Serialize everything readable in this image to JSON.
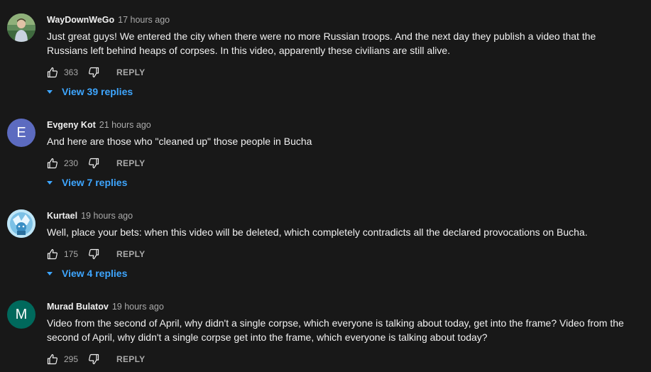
{
  "comments": [
    {
      "author": "WayDownWeGo",
      "time": "17 hours ago",
      "text": "Just great guys! We entered the city when there were no more Russian troops. And the next day they publish a video that the Russians left behind heaps of corpses. In this video, apparently these civilians are still alive.",
      "likes": "363",
      "reply_label": "REPLY",
      "view_replies": "View 39 replies",
      "avatar": {
        "type": "photo",
        "icon": "user-photo"
      }
    },
    {
      "author": "Evgeny Kot",
      "time": "21 hours ago",
      "text": "And here are those who \"cleaned up\" those people in Bucha",
      "likes": "230",
      "reply_label": "REPLY",
      "view_replies": "View 7 replies",
      "avatar": {
        "type": "letter",
        "letter": "E",
        "color": "#5c6bc0"
      }
    },
    {
      "author": "Kurtael",
      "time": "19 hours ago",
      "text": "Well, place your bets: when this video will be deleted, which completely contradicts all the declared provocations on Bucha.",
      "likes": "175",
      "reply_label": "REPLY",
      "view_replies": "View 4 replies",
      "avatar": {
        "type": "photo",
        "icon": "character-photo"
      }
    },
    {
      "author": "Murad Bulatov",
      "time": "19 hours ago",
      "text": "Video from the second of April, why didn't a single corpse, which everyone is talking about today, get into the frame? Video from the second of April, why didn't a single corpse get into the frame, which everyone is talking about today?",
      "likes": "295",
      "reply_label": "REPLY",
      "avatar": {
        "type": "letter",
        "letter": "M",
        "color": "#00695c"
      }
    }
  ],
  "colors": {
    "background": "#181818",
    "text": "#f1f1f1",
    "secondary": "#aaaaaa",
    "link": "#3ea6ff"
  }
}
